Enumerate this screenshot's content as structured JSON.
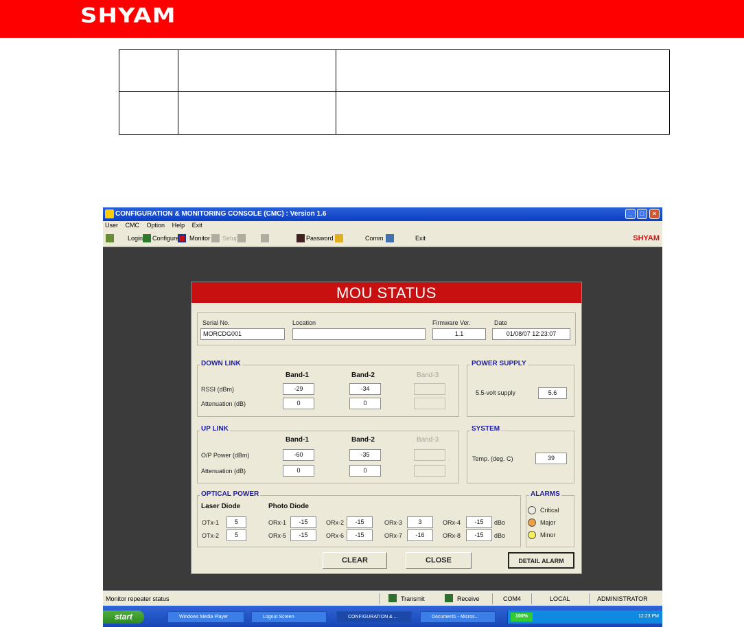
{
  "doc": {
    "brand": "SHYAM"
  },
  "app": {
    "title": "CONFIGURATION & MONITORING CONSOLE (CMC) : Version 1.6",
    "menu": [
      "User",
      "CMC",
      "Option",
      "Help",
      "Exit"
    ],
    "toolbar": {
      "login": "Login",
      "configure": "Configure",
      "monitor": "Monitor",
      "setup": "Setup",
      "password": "Password",
      "comm": "Comm",
      "exit": "Exit",
      "brand": "SHYAM"
    }
  },
  "mou": {
    "title": "MOU STATUS",
    "info": {
      "serial_label": "Serial No.",
      "serial_value": "MORCDG001",
      "location_label": "Location",
      "location_value": "",
      "firmware_label": "Firmware Ver.",
      "firmware_value": "1.1",
      "date_label": "Date",
      "date_value": "01/08/07 12:23:07"
    },
    "downlink": {
      "title": "DOWN LINK",
      "bands": [
        "Band-1",
        "Band-2",
        "Band-3"
      ],
      "rows": [
        {
          "label": "RSSI (dBm)",
          "values": [
            "-29",
            "-34",
            ""
          ]
        },
        {
          "label": "Attenuation (dB)",
          "values": [
            "0",
            "0",
            ""
          ]
        }
      ]
    },
    "uplink": {
      "title": "UP LINK",
      "bands": [
        "Band-1",
        "Band-2",
        "Band-3"
      ],
      "rows": [
        {
          "label": "O/P Power (dBm)",
          "values": [
            "-60",
            "-35",
            ""
          ]
        },
        {
          "label": "Attenuation (dB)",
          "values": [
            "0",
            "0",
            ""
          ]
        }
      ]
    },
    "power_supply": {
      "title": "POWER SUPPLY",
      "label": "5.5-volt supply",
      "value": "5.6"
    },
    "system": {
      "title": "SYSTEM",
      "label": "Temp. (deg. C)",
      "value": "39"
    },
    "optical": {
      "title": "OPTICAL POWER",
      "laser_header": "Laser Diode",
      "photo_header": "Photo Diode",
      "otx": [
        {
          "label": "OTx-1",
          "value": "5"
        },
        {
          "label": "OTx-2",
          "value": "5"
        }
      ],
      "orx": [
        {
          "label": "ORx-1",
          "value": "-15"
        },
        {
          "label": "ORx-2",
          "value": "-15"
        },
        {
          "label": "ORx-3",
          "value": "3"
        },
        {
          "label": "ORx-4",
          "value": "-15"
        },
        {
          "label": "ORx-5",
          "value": "-15"
        },
        {
          "label": "ORx-6",
          "value": "-15"
        },
        {
          "label": "ORx-7",
          "value": "-16"
        },
        {
          "label": "ORx-8",
          "value": "-15"
        }
      ],
      "unit": "dBo"
    },
    "alarms": {
      "title": "ALARMS",
      "items": [
        {
          "label": "Critical",
          "color": "#ecebe0"
        },
        {
          "label": "Major",
          "color": "#f0a040"
        },
        {
          "label": "Minor",
          "color": "#f5f05a"
        }
      ]
    },
    "buttons": {
      "clear": "CLEAR",
      "close": "CLOSE",
      "detail": "DETAIL ALARM"
    }
  },
  "statusbar": {
    "message": "Monitor repeater status",
    "transmit": "Transmit",
    "receive": "Receive",
    "port": "COM4",
    "mode": "LOCAL",
    "user": "ADMINISTRATOR"
  },
  "taskbar": {
    "start": "start",
    "tasks": [
      "Windows Media Player",
      "Logout Screen",
      "CONFIGURATION & ...",
      "Document1 - Micros..."
    ],
    "zoom": "100%",
    "time": "12:23 PM"
  },
  "colors": {
    "brand_red": "#ff0000",
    "panel_title_red": "#c81010",
    "group_label_blue": "#2020a8"
  }
}
